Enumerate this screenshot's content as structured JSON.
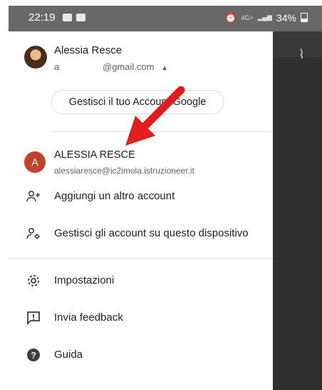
{
  "status_bar": {
    "time": "22:19",
    "net_label": "4G+",
    "battery": "34%"
  },
  "account": {
    "name": "Alessia Resce",
    "email_prefix": "a",
    "email_suffix": "@gmail.com",
    "manage_button": "Gestisci il tuo Account Google"
  },
  "second_account": {
    "avatar_letter": "A",
    "name": "ALESSIA RESCE",
    "email": "alessiaresce@ic2imola.istruzioneer.it"
  },
  "menu": {
    "add_account": "Aggiungi un altro account",
    "manage_accounts": "Gestisci gli account su questo dispositivo",
    "settings": "Impostazioni",
    "feedback": "Invia feedback",
    "help": "Guida"
  },
  "colors": {
    "accent_red": "#e11d1d",
    "avatar_red": "#c0412d",
    "status_bar": "#686868",
    "background_dark": "#303030"
  }
}
